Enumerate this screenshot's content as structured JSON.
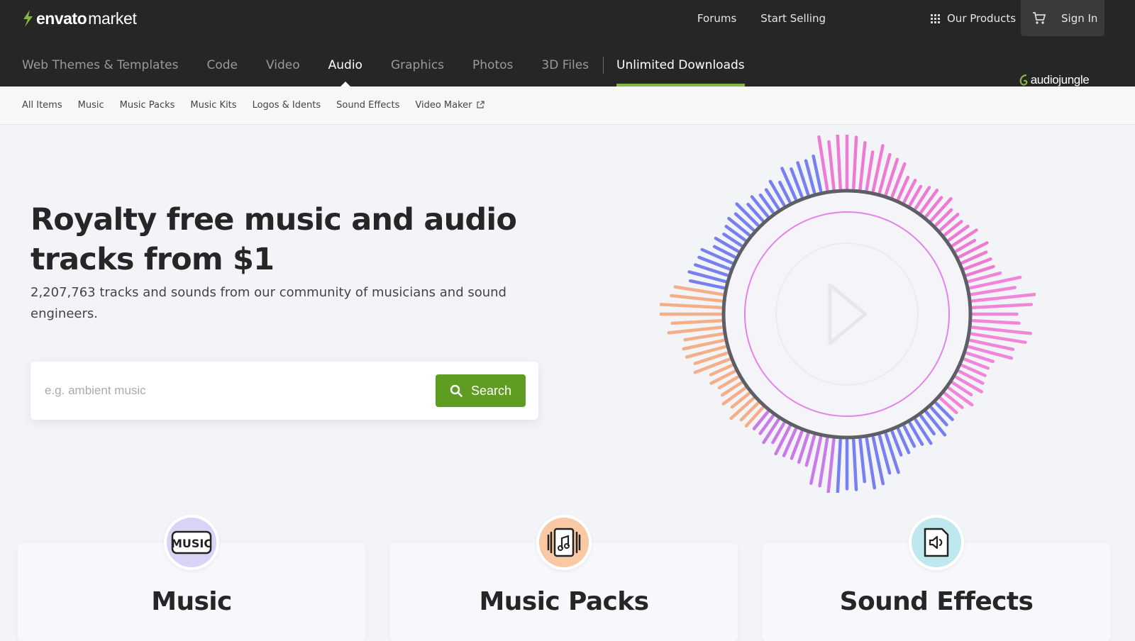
{
  "header": {
    "logo_brand": "envato",
    "logo_suffix": "market",
    "top_links": [
      "Forums",
      "Start Selling",
      "Our Products"
    ],
    "sign_in": "Sign In",
    "main_nav": [
      "Web Themes & Templates",
      "Code",
      "Video",
      "Audio",
      "Graphics",
      "Photos",
      "3D Files"
    ],
    "unlimited": "Unlimited Downloads",
    "active": "Audio",
    "site_badge": "audiojungle"
  },
  "subnav": {
    "items": [
      "All Items",
      "Music",
      "Music Packs",
      "Music Kits",
      "Logos & Idents",
      "Sound Effects"
    ],
    "external": "Video Maker"
  },
  "hero": {
    "title": "Royalty free music and audio tracks from $1",
    "subtitle": "2,207,763 tracks and sounds from our community of musicians and sound engineers.",
    "search_placeholder": "e.g. ambient music",
    "search_button": "Search"
  },
  "categories": [
    {
      "title": "Music",
      "icon": "music-label-icon",
      "color": "#d9d4f5"
    },
    {
      "title": "Music Packs",
      "icon": "music-pack-icon",
      "color": "#f8c9a4"
    },
    {
      "title": "Sound Effects",
      "icon": "speaker-file-icon",
      "color": "#bfe7ee"
    }
  ],
  "colors": {
    "accent": "#82b541",
    "button": "#5e9c22",
    "topbar": "#262626"
  }
}
